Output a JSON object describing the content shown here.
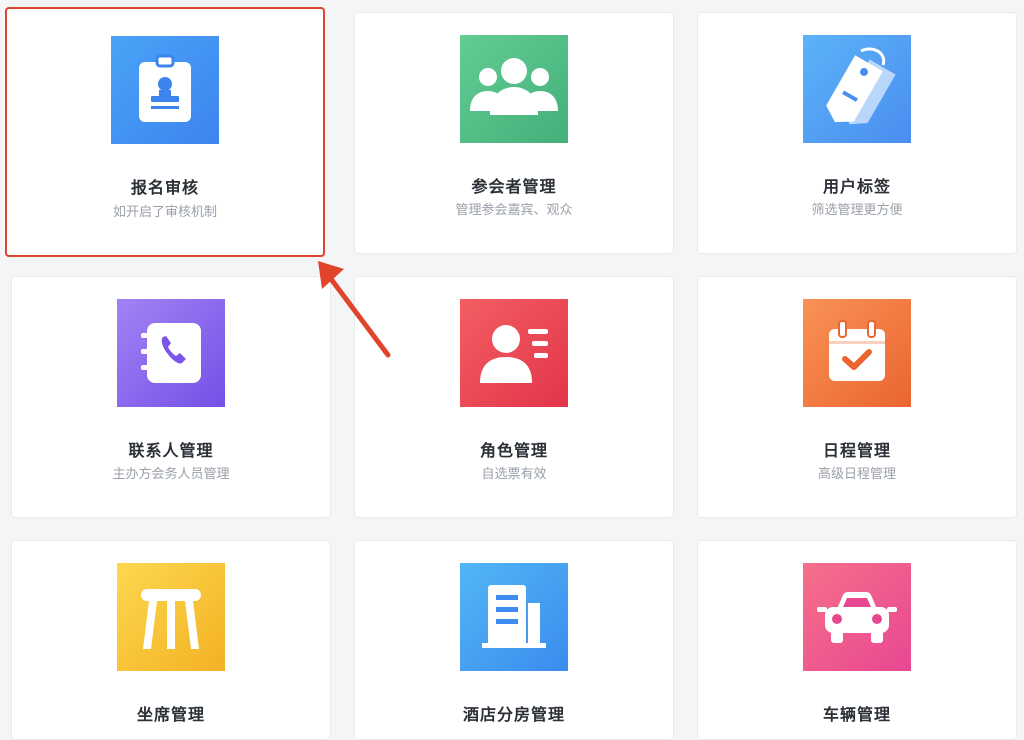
{
  "cards": [
    {
      "title": "报名审核",
      "subtitle": "如开启了审核机制",
      "icon": "id-badge-icon",
      "gradient": [
        "#4a9ff5",
        "#3f86f0"
      ]
    },
    {
      "title": "参会者管理",
      "subtitle": "管理参会嘉宾、观众",
      "icon": "group-icon",
      "gradient": [
        "#5cc78d",
        "#45b27a"
      ]
    },
    {
      "title": "用户标签",
      "subtitle": "筛选管理更方便",
      "icon": "tags-icon",
      "gradient": [
        "#5aaef7",
        "#4a90f0"
      ]
    },
    {
      "title": "联系人管理",
      "subtitle": "主办方会务人员管理",
      "icon": "phone-book-icon",
      "gradient": [
        "#9b7cf3",
        "#7b55e8"
      ]
    },
    {
      "title": "角色管理",
      "subtitle": "自选票有效",
      "icon": "user-list-icon",
      "gradient": [
        "#f0595c",
        "#e4374a"
      ]
    },
    {
      "title": "日程管理",
      "subtitle": "高级日程管理",
      "icon": "calendar-check-icon",
      "gradient": [
        "#f78a4e",
        "#ec6a33"
      ]
    },
    {
      "title": "坐席管理",
      "subtitle": "",
      "icon": "stool-icon",
      "gradient": [
        "#fbd24a",
        "#f5b628"
      ]
    },
    {
      "title": "酒店分房管理",
      "subtitle": "",
      "icon": "building-icon",
      "gradient": [
        "#4fb2f5",
        "#3d90ef"
      ]
    },
    {
      "title": "车辆管理",
      "subtitle": "",
      "icon": "car-icon",
      "gradient": [
        "#f66b8a",
        "#e94b8f"
      ]
    }
  ],
  "highlight_color": "#e0442c"
}
